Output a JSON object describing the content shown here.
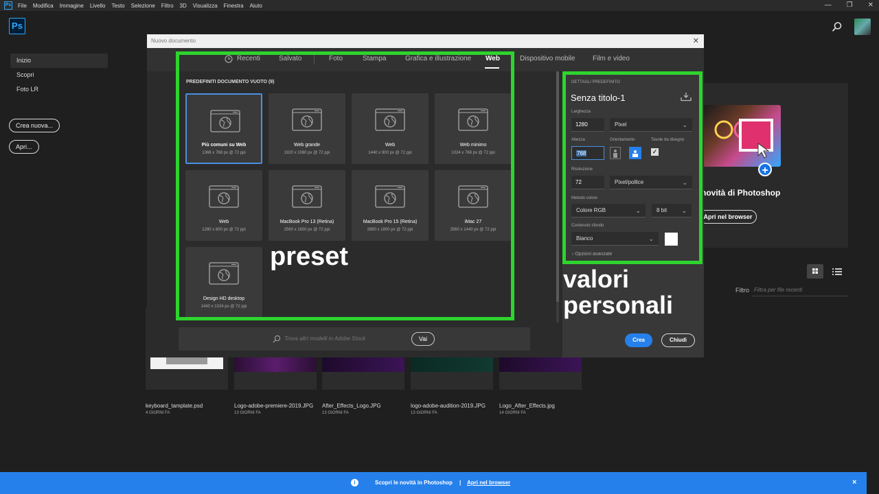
{
  "menubar": {
    "app_icon": "Ps",
    "items": [
      "File",
      "Modifica",
      "Immagine",
      "Livello",
      "Testo",
      "Selezione",
      "Filtro",
      "3D",
      "Visualizza",
      "Finestra",
      "Aiuto"
    ],
    "window_controls": [
      "—",
      "❐",
      "✕"
    ]
  },
  "header": {
    "logo": "Ps",
    "search_icon": "search-icon",
    "avatar_icon": "user-avatar"
  },
  "nav": {
    "items": [
      {
        "label": "Inizio",
        "active": true
      },
      {
        "label": "Scopri",
        "active": false
      },
      {
        "label": "Foto LR",
        "active": false
      }
    ],
    "new_button": "Crea nuova...",
    "open_button": "Apri..."
  },
  "home": {
    "promo_title": "novità di Photoshop",
    "promo_button": "Apri nel browser",
    "filter_label": "Filtro",
    "filter_placeholder": "Filtra per file recenti",
    "recent_files": [
      {
        "name": "keyboard_tamplate.psd",
        "age": "4 GIORNI FA"
      },
      {
        "name": "Logo-adobe-premiere-2019.JPG",
        "age": "13 GIORNI FA"
      },
      {
        "name": "After_Effects_Logo.JPG",
        "age": "13 GIORNI FA"
      },
      {
        "name": "logo-adobe-audition-2019.JPG",
        "age": "13 GIORNI FA"
      },
      {
        "name": "Logo_After_Effects.jpg",
        "age": "14 GIORNI FA"
      }
    ]
  },
  "banner": {
    "info_icon": "i",
    "text": "Scopri le novità in Photoshop",
    "separator": "|",
    "link": "Apri nel browser",
    "close": "×"
  },
  "dialog": {
    "title": "Nuovo documento",
    "close": "✕",
    "tabs": [
      "Recenti",
      "Salvato",
      "Foto",
      "Stampa",
      "Grafica e illustrazione",
      "Web",
      "Dispositivo mobile",
      "Film e video"
    ],
    "active_tab": "Web",
    "section_title": "PREDEFINITI DOCUMENTO VUOTO",
    "section_count": "(9)",
    "presets": [
      {
        "name": "Più comuni su Web",
        "size": "1366 x 768 px @ 72 ppi",
        "selected": true
      },
      {
        "name": "Web grande",
        "size": "1920 x 1080 px @ 72 ppi"
      },
      {
        "name": "Web",
        "size": "1440 x 900 px @ 72 ppi"
      },
      {
        "name": "Web minimo",
        "size": "1024 x 768 px @ 72 ppi"
      },
      {
        "name": "Web",
        "size": "1280 x 800 px @ 72 ppi"
      },
      {
        "name": "MacBook Pro 13 (Retina)",
        "size": "2560 x 1600 px @ 72 ppi"
      },
      {
        "name": "MacBook Pro 15 (Retina)",
        "size": "2880 x 1800 px @ 72 ppi"
      },
      {
        "name": "iMac 27",
        "size": "2560 x 1440 px @ 72 ppi"
      },
      {
        "name": "Design HD desktop",
        "size": "1440 x 1024 px @ 72 ppi"
      }
    ],
    "stock_placeholder": "Trova altri modelli in Adobe Stock",
    "stock_button": "Vai"
  },
  "details": {
    "header": "DETTAGLI PREDEFINITO",
    "doc_name": "Senza titolo-1",
    "width_label": "Larghezza",
    "width_value": "1280",
    "width_unit": "Pixel",
    "height_label": "Altezza",
    "height_value": "768",
    "orientation_label": "Orientamento",
    "artboards_label": "Tavole da disegno",
    "artboards_checked": true,
    "resolution_label": "Risoluzione",
    "resolution_value": "72",
    "resolution_unit": "Pixel/pollice",
    "color_mode_label": "Metodo colore",
    "color_mode_value": "Colore RGB",
    "bit_depth": "8 bit",
    "background_label": "Contenuto sfondo",
    "background_value": "Bianco",
    "background_color": "#ffffff",
    "advanced_label": "Opzioni avanzate",
    "create_button": "Crea",
    "close_button": "Chiudi"
  },
  "annotations": {
    "preset_label": "preset",
    "custom_label_line1": "valori",
    "custom_label_line2": "personali",
    "highlight_color": "#2ed42e"
  }
}
